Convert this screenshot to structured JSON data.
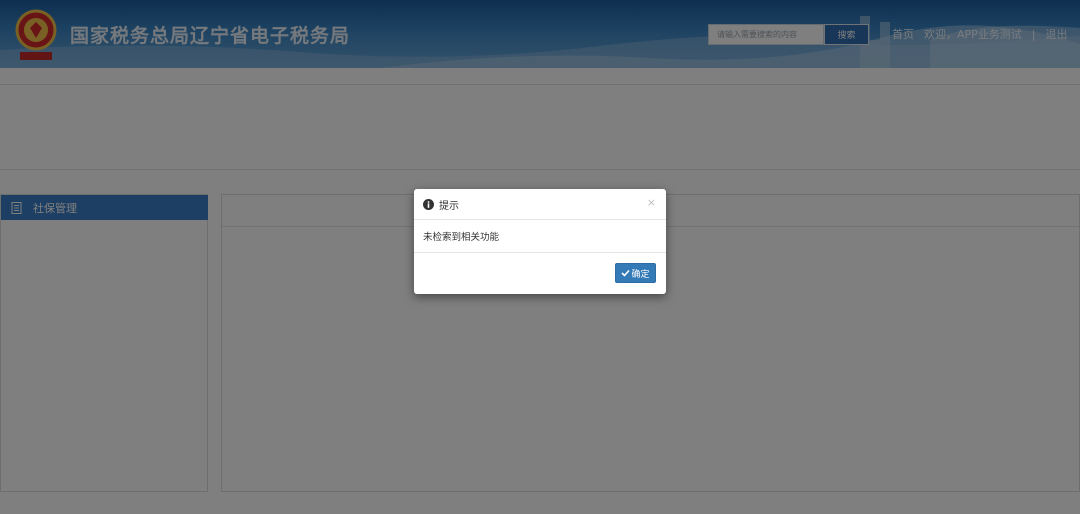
{
  "header": {
    "title": "国家税务总局辽宁省电子税务局",
    "search": {
      "placeholder": "请输入需要搜索的内容",
      "button_label": "搜索"
    },
    "links": {
      "home": "首页",
      "welcome": "欢迎，APP业务测试",
      "separator": "|",
      "logout": "退出"
    }
  },
  "sidebar": {
    "items": [
      {
        "label": "社保管理",
        "icon": "document-list-icon"
      }
    ]
  },
  "dialog": {
    "title": "提示",
    "icon": "info-circle-icon",
    "message": "未检索到相关功能",
    "close_symbol": "×",
    "confirm_label": "确定"
  },
  "colors": {
    "header_blue": "#2f6db0",
    "sidebar_active": "#3d7fc8",
    "primary_button": "#337ab7",
    "overlay": "rgba(0,0,0,0.5)"
  }
}
